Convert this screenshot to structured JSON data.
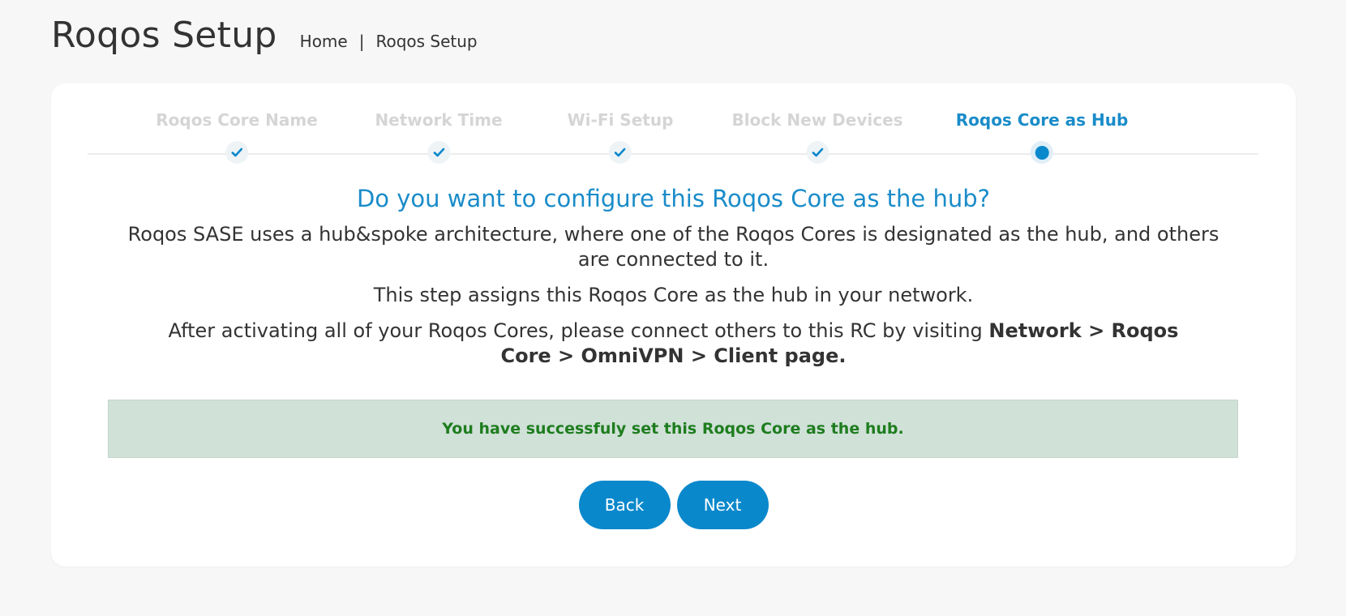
{
  "header": {
    "title": "Roqos Setup",
    "breadcrumb": {
      "home": "Home",
      "separator": "|",
      "current": "Roqos Setup"
    }
  },
  "stepper": {
    "steps": [
      {
        "label": "Roqos Core Name",
        "state": "completed"
      },
      {
        "label": "Network Time",
        "state": "completed"
      },
      {
        "label": "Wi-Fi Setup",
        "state": "completed"
      },
      {
        "label": "Block New Devices",
        "state": "completed"
      },
      {
        "label": "Roqos Core as Hub",
        "state": "active"
      }
    ]
  },
  "content": {
    "question": "Do you want to configure this Roqos Core as the hub?",
    "paragraph1": "Roqos SASE uses a hub&spoke architecture, where one of the Roqos Cores is designated as the hub, and others are connected to it.",
    "paragraph2": "This step assigns this Roqos Core as the hub in your network.",
    "paragraph3_prefix": "After activating all of your Roqos Cores, please connect others to this RC by visiting ",
    "paragraph3_bold": "Network > Roqos Core > OmniVPN > Client page."
  },
  "alert": {
    "message": "You have successfuly set this Roqos Core as the hub."
  },
  "buttons": {
    "back": "Back",
    "next": "Next"
  },
  "colors": {
    "accent": "#0a88cc",
    "completed_label": "#d5d5d5",
    "success_bg": "#d0e1d8",
    "success_text": "#1e7d1e"
  },
  "icons": {
    "completed": "check-icon",
    "active": "active-dot-icon"
  }
}
